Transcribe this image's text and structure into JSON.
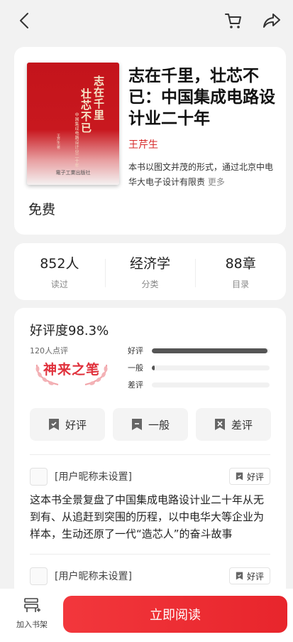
{
  "book": {
    "cover_title_line1": "志在千里",
    "cover_title_line2": "壮芯不已",
    "cover_subtitle": "中国集成电路设计业二十年",
    "cover_subtitle2": "王芹生 著",
    "cover_publisher": "電子工業出版社",
    "title": "志在千里，壮芯不已：中国集成电路设计业二十年",
    "author": "王芹生",
    "description": "本书以图文并茂的形式，通过北京中电华大电子设计有限责",
    "more_label": "更多",
    "price": "免费"
  },
  "stats": [
    {
      "value": "852人",
      "label": "读过"
    },
    {
      "value": "经济学",
      "label": "分类"
    },
    {
      "value": "88章",
      "label": "目录"
    }
  ],
  "rating": {
    "title": "好评度98.3%",
    "count": "120人点评",
    "badge": "神来之笔",
    "bars": [
      {
        "label": "好评",
        "fraction": 0.983
      },
      {
        "label": "一般",
        "fraction": 0.017
      },
      {
        "label": "差评",
        "fraction": 0.0
      }
    ],
    "vote_buttons": [
      {
        "label": "好评",
        "icon": "thumbs-up-bookmark-icon"
      },
      {
        "label": "一般",
        "icon": "bookmark-icon"
      },
      {
        "label": "差评",
        "icon": "thumbs-down-bookmark-icon"
      }
    ]
  },
  "reviews": [
    {
      "user": "[用户昵称未设置]",
      "tag": "好评",
      "text": "这本书全景复盘了中国集成电路设计业二十年从无到有、从追赶到突围的历程，以中电华大等企业为样本，生动还原了一代“造芯人”的奋斗故事"
    },
    {
      "user": "[用户昵称未设置]",
      "tag": "好评",
      "text": ""
    }
  ],
  "bottom": {
    "shelf_label": "加入书架",
    "read_label": "立即阅读"
  },
  "colors": {
    "accent": "#e8252c",
    "author": "#d62a2a",
    "background": "#f2f2f2"
  }
}
